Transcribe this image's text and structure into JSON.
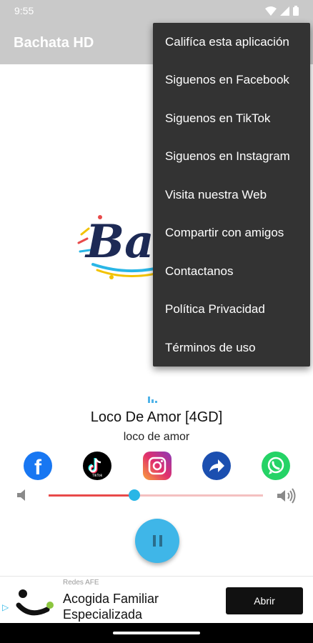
{
  "status_bar": {
    "time": "9:55",
    "icons": [
      "wifi-icon",
      "signal-icon",
      "battery-icon"
    ]
  },
  "app_bar": {
    "title": "Bachata HD"
  },
  "logo": {
    "text": "Bachata"
  },
  "menu": {
    "items": [
      {
        "label": "Califíca esta aplicación"
      },
      {
        "label": "Siguenos en Facebook"
      },
      {
        "label": "Siguenos en TikTok"
      },
      {
        "label": "Siguenos en Instagram"
      },
      {
        "label": "Visita nuestra Web"
      },
      {
        "label": "Compartir con amigos"
      },
      {
        "label": "Contactanos"
      },
      {
        "label": "Política Privacidad"
      },
      {
        "label": "Términos de uso"
      }
    ]
  },
  "player": {
    "title": "Loco De Amor [4GD]",
    "subtitle": "loco de amor",
    "volume_fraction": 0.4
  },
  "social": [
    {
      "name": "facebook-icon",
      "color": "#1877f2"
    },
    {
      "name": "tiktok-icon",
      "color": "#000000",
      "caption": "TikTok"
    },
    {
      "name": "instagram-icon",
      "color": "#e1306c"
    },
    {
      "name": "share-icon",
      "color": "#1b4fb0"
    },
    {
      "name": "whatsapp-icon",
      "color": "#25d366"
    }
  ],
  "ad": {
    "source": "Redes AFE",
    "title": "Acogida Familiar Especializada",
    "cta": "Abrir"
  },
  "colors": {
    "app_bar": "#c9c9c9",
    "menu_bg": "#333333",
    "accent": "#29b6e6",
    "volume_fill": "#e84a4a"
  }
}
